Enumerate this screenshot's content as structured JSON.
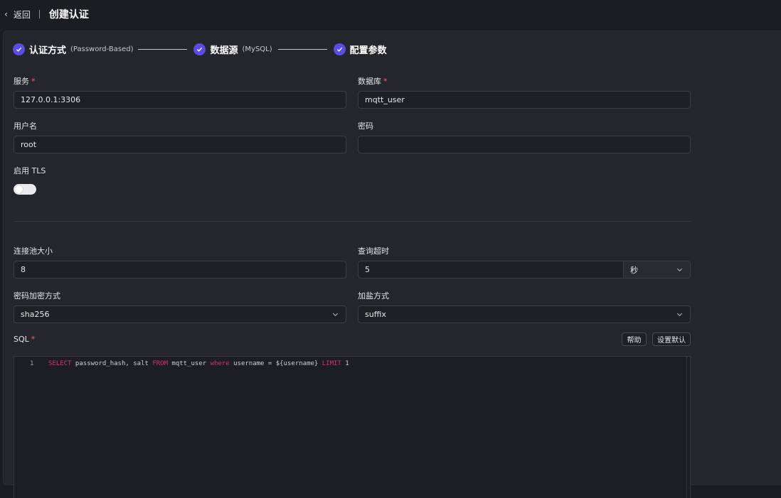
{
  "header": {
    "back_label": "返回",
    "title": "创建认证"
  },
  "steps": [
    {
      "title": "认证方式",
      "sub": "(Password-Based)"
    },
    {
      "title": "数据源",
      "sub": "(MySQL)"
    },
    {
      "title": "配置参数",
      "sub": ""
    }
  ],
  "form": {
    "server": {
      "label": "服务",
      "value": "127.0.0.1:3306"
    },
    "database": {
      "label": "数据库",
      "value": "mqtt_user"
    },
    "username": {
      "label": "用户名",
      "value": "root"
    },
    "password": {
      "label": "密码",
      "value": ""
    },
    "tls": {
      "label": "启用 TLS",
      "enabled": false
    },
    "pool_size": {
      "label": "连接池大小",
      "value": "8"
    },
    "query_timeout": {
      "label": "查询超时",
      "value": "5",
      "unit": "秒"
    },
    "password_hash": {
      "label": "密码加密方式",
      "value": "sha256"
    },
    "salt_position": {
      "label": "加盐方式",
      "value": "suffix"
    },
    "sql": {
      "label": "SQL",
      "help_button": "帮助",
      "default_button": "设置默认",
      "line_number": "1",
      "tokens": [
        {
          "t": "SELECT",
          "kw": true
        },
        {
          "t": " password_hash, salt ",
          "kw": false
        },
        {
          "t": "FROM",
          "kw": true
        },
        {
          "t": " mqtt_user ",
          "kw": false
        },
        {
          "t": "where",
          "kw": true
        },
        {
          "t": " username = ${username} ",
          "kw": false
        },
        {
          "t": "LIMIT",
          "kw": true
        },
        {
          "t": " 1",
          "kw": false
        }
      ]
    },
    "required_mark": "*"
  },
  "colors": {
    "accent": "#5a4ce6",
    "required": "#f06261",
    "keyword": "#d6336c"
  }
}
